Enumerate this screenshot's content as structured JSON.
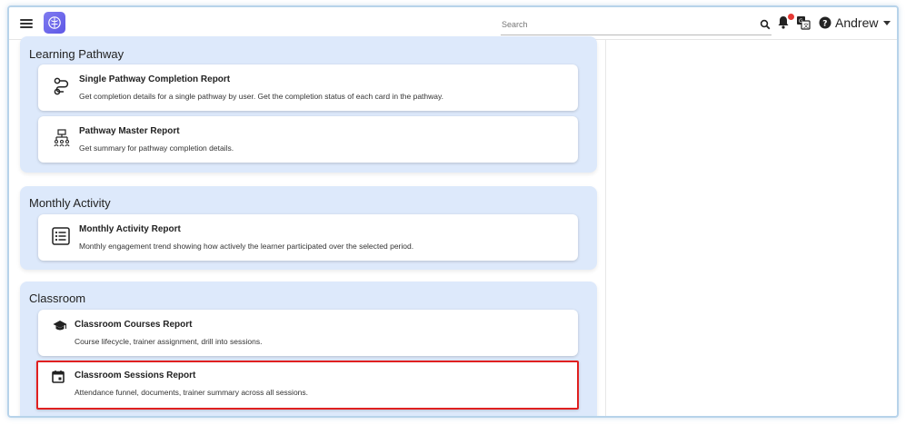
{
  "header": {
    "search_placeholder": "Search",
    "user_name": "Andrew"
  },
  "colors": {
    "accent": "#6a64ea",
    "section_bg": "#dde9fb",
    "highlight": "#e02020",
    "notification": "#e53935"
  },
  "sections": [
    {
      "title": "Learning Pathway",
      "cards": [
        {
          "icon": "route-icon",
          "title": "Single Pathway Completion Report",
          "desc": "Get completion details for a single pathway by user. Get the completion status of each card in the pathway."
        },
        {
          "icon": "hierarchy-icon",
          "title": "Pathway Master Report",
          "desc": "Get summary for pathway completion details."
        }
      ]
    },
    {
      "title": "Monthly Activity",
      "cards": [
        {
          "icon": "list-icon",
          "title": "Monthly Activity Report",
          "desc": "Monthly engagement trend showing how actively the learner participated over the selected period."
        }
      ]
    },
    {
      "title": "Classroom",
      "cards": [
        {
          "icon": "graduation-cap-icon",
          "title": "Classroom Courses Report",
          "desc": "Course lifecycle, trainer assignment, drill into sessions."
        },
        {
          "icon": "calendar-icon",
          "title": "Classroom Sessions Report",
          "desc": "Attendance funnel, documents, trainer summary across all sessions."
        }
      ]
    }
  ]
}
